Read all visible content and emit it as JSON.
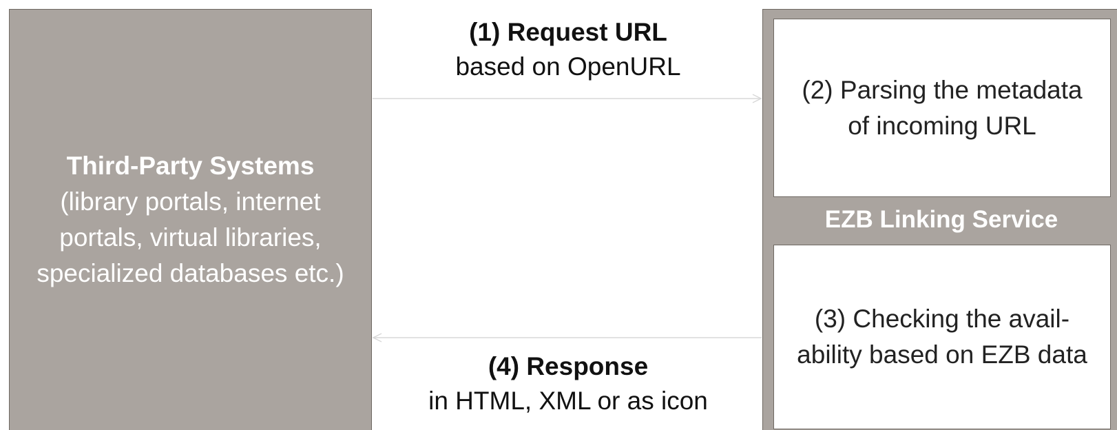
{
  "third_party": {
    "title": "Third-Party Systems",
    "description": "(library portals, internet\nportals, virtual libraries,\nspecialized databases etc.)"
  },
  "linking_service": {
    "label": "EZB Linking Service",
    "step2": "(2) Parsing the metadata\nof incoming URL",
    "step3": "(3) Checking the avail-\nability based on EZB data"
  },
  "request": {
    "title": "(1) Request URL",
    "subtitle": "based on OpenURL"
  },
  "response": {
    "title": "(4) Response",
    "subtitle": "in HTML, XML or as icon"
  },
  "colors": {
    "box_fill": "#aaa49f",
    "box_border": "#6e6862",
    "arrow": "#d8d8d8"
  }
}
